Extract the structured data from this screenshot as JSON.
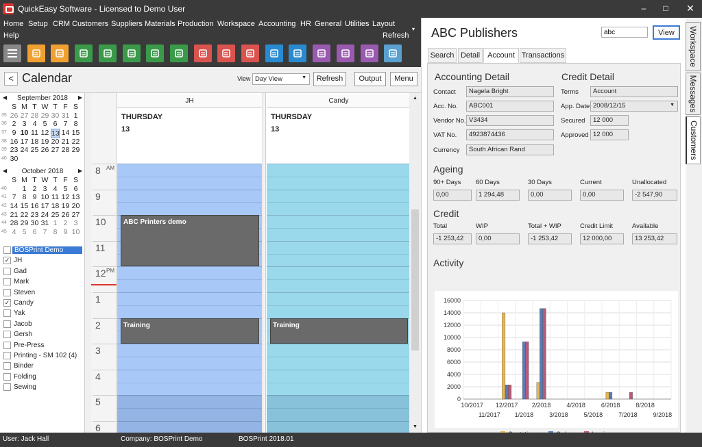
{
  "window": {
    "title": "QuickEasy Software - Licensed to Demo User"
  },
  "menu": [
    "Home",
    "Setup",
    "CRM",
    "Customers",
    "Suppliers",
    "Materials",
    "Production",
    "Workspace",
    "Accounting",
    "HR",
    "General",
    "Utilities",
    "Layout"
  ],
  "menu2": {
    "help": "Help",
    "refresh": "Refresh"
  },
  "toolbar_icons": [
    {
      "name": "menu-icon",
      "color": "#888888"
    },
    {
      "name": "calendar-icon",
      "color": "#f0a030"
    },
    {
      "name": "mail-icon",
      "color": "#f0a030"
    },
    {
      "name": "user-icon",
      "color": "#3a9a4a"
    },
    {
      "name": "chat-icon",
      "color": "#3a9a4a"
    },
    {
      "name": "cart-icon",
      "color": "#3a9a4a"
    },
    {
      "name": "truck-icon",
      "color": "#3a9a4a"
    },
    {
      "name": "document-icon",
      "color": "#3a9a4a"
    },
    {
      "name": "person-icon",
      "color": "#d9534f"
    },
    {
      "name": "cart-add-icon",
      "color": "#d9534f"
    },
    {
      "name": "invoice-icon",
      "color": "#d9534f"
    },
    {
      "name": "card-icon",
      "color": "#2a8ad0"
    },
    {
      "name": "transfer-icon",
      "color": "#2a8ad0"
    },
    {
      "name": "factory-icon",
      "color": "#9a5ab0"
    },
    {
      "name": "hierarchy-icon",
      "color": "#9a5ab0"
    },
    {
      "name": "hourglass-icon",
      "color": "#9a5ab0"
    },
    {
      "name": "book-icon",
      "color": "#5aa0d0"
    }
  ],
  "calendar": {
    "title": "Calendar",
    "view_label": "View",
    "view_value": "Day View",
    "refresh": "Refresh",
    "output": "Output",
    "menu": "Menu",
    "back": "<"
  },
  "minical1": {
    "title": "September 2018",
    "days": [
      "S",
      "M",
      "T",
      "W",
      "T",
      "F",
      "S"
    ],
    "weeks": [
      {
        "wk": "35",
        "days": [
          "26",
          "27",
          "28",
          "29",
          "30",
          "31",
          "1"
        ]
      },
      {
        "wk": "36",
        "days": [
          "2",
          "3",
          "4",
          "5",
          "6",
          "7",
          "8"
        ]
      },
      {
        "wk": "37",
        "days": [
          "9",
          "10",
          "11",
          "12",
          "13",
          "14",
          "15"
        ]
      },
      {
        "wk": "38",
        "days": [
          "16",
          "17",
          "18",
          "19",
          "20",
          "21",
          "22"
        ]
      },
      {
        "wk": "39",
        "days": [
          "23",
          "24",
          "25",
          "26",
          "27",
          "28",
          "29"
        ]
      },
      {
        "wk": "40",
        "days": [
          "30",
          "",
          "",
          "",
          "",
          "",
          ""
        ]
      }
    ]
  },
  "minical2": {
    "title": "October 2018",
    "days": [
      "S",
      "M",
      "T",
      "W",
      "T",
      "F",
      "S"
    ],
    "weeks": [
      {
        "wk": "40",
        "days": [
          "",
          "1",
          "2",
          "3",
          "4",
          "5",
          "6"
        ]
      },
      {
        "wk": "41",
        "days": [
          "7",
          "8",
          "9",
          "10",
          "11",
          "12",
          "13"
        ]
      },
      {
        "wk": "42",
        "days": [
          "14",
          "15",
          "16",
          "17",
          "18",
          "19",
          "20"
        ]
      },
      {
        "wk": "43",
        "days": [
          "21",
          "22",
          "23",
          "24",
          "25",
          "26",
          "27"
        ]
      },
      {
        "wk": "44",
        "days": [
          "28",
          "29",
          "30",
          "31",
          "1",
          "2",
          "3"
        ]
      },
      {
        "wk": "45",
        "days": [
          "4",
          "5",
          "6",
          "7",
          "8",
          "9",
          "10"
        ]
      }
    ]
  },
  "resources": [
    {
      "label": "BOSPrint Demo",
      "checked": false,
      "selected": true
    },
    {
      "label": "JH",
      "checked": true
    },
    {
      "label": "Gad",
      "checked": false
    },
    {
      "label": "Mark",
      "checked": false
    },
    {
      "label": "Steven",
      "checked": false
    },
    {
      "label": "Candy",
      "checked": true
    },
    {
      "label": "Yak",
      "checked": false
    },
    {
      "label": "Jacob",
      "checked": false
    },
    {
      "label": "Gersh",
      "checked": false
    },
    {
      "label": "Pre-Press",
      "checked": false
    },
    {
      "label": "Printing - SM 102 (4)",
      "checked": false
    },
    {
      "label": "Binder",
      "checked": false
    },
    {
      "label": "Folding",
      "checked": false
    },
    {
      "label": "Sewing",
      "checked": false
    }
  ],
  "dayview": {
    "columns": [
      {
        "name": "JH",
        "day": "THURSDAY",
        "date": "13",
        "color": "#a8c8f8"
      },
      {
        "name": "Candy",
        "day": "THURSDAY",
        "date": "13",
        "color": "#9ad8ec"
      }
    ],
    "hours": [
      {
        "h": "8",
        "suffix": "AM"
      },
      {
        "h": "9",
        "suffix": ""
      },
      {
        "h": "10",
        "suffix": ""
      },
      {
        "h": "11",
        "suffix": ""
      },
      {
        "h": "12",
        "suffix": "PM"
      },
      {
        "h": "1",
        "suffix": ""
      },
      {
        "h": "2",
        "suffix": ""
      },
      {
        "h": "3",
        "suffix": ""
      },
      {
        "h": "4",
        "suffix": ""
      },
      {
        "h": "5",
        "suffix": ""
      },
      {
        "h": "6",
        "suffix": ""
      }
    ],
    "appointments": [
      {
        "col": 0,
        "title": "ABC Printers demo",
        "start": 10,
        "end": 12
      },
      {
        "col": 0,
        "title": "Training",
        "start": 14,
        "end": 15
      },
      {
        "col": 1,
        "title": "Training",
        "start": 14,
        "end": 15
      }
    ]
  },
  "customer": {
    "name": "ABC Publishers",
    "search_value": "abc",
    "view": "View",
    "tabs": [
      "Search",
      "Detail",
      "Account",
      "Transactions"
    ],
    "active_tab": "Account",
    "accounting_detail": "Accounting Detail",
    "credit_detail": "Credit Detail",
    "fields": {
      "contact_label": "Contact",
      "contact": "Nagela Bright",
      "acc_label": "Acc. No.",
      "acc": "ABC001",
      "vendor_label": "Vendor No.",
      "vendor": "V3434",
      "vat_label": "VAT No.",
      "vat": "4923874436",
      "currency_label": "Currency",
      "currency": "South African Rand",
      "terms_label": "Terms",
      "terms": "Account",
      "appdate_label": "App. Date",
      "appdate": "2008/12/15",
      "secured_label": "Secured",
      "secured": "12 000",
      "approved_label": "Approved",
      "approved": "12 000"
    },
    "ageing": {
      "title": "Ageing",
      "labels": [
        "90+ Days",
        "60 Days",
        "30 Days",
        "Current",
        "Unallocated"
      ],
      "values": [
        "0,00",
        "1 294,48",
        "0,00",
        "0,00",
        "-2 547,90"
      ]
    },
    "credit": {
      "title": "Credit",
      "labels": [
        "Total",
        "WIP",
        "Total + WIP",
        "Credit Limit",
        "Available"
      ],
      "values": [
        "-1 253,42",
        "0,00",
        "-1 253,42",
        "12 000,00",
        "13 253,42"
      ]
    },
    "activity_title": "Activity"
  },
  "chart_data": {
    "type": "bar",
    "categories": [
      "10/2017",
      "11/2017",
      "12/2017",
      "1/2018",
      "2/2018",
      "3/2018",
      "4/2018",
      "5/2018",
      "6/2018",
      "7/2018",
      "8/2018",
      "9/2018"
    ],
    "series": [
      {
        "name": "Quotations",
        "color": "#e8b850",
        "values": [
          0,
          0,
          14000,
          0,
          2700,
          0,
          0,
          0,
          1100,
          0,
          0,
          0
        ]
      },
      {
        "name": "Orders",
        "color": "#5a7ab8",
        "values": [
          0,
          0,
          2300,
          9300,
          14700,
          0,
          0,
          0,
          1100,
          0,
          0,
          0
        ]
      },
      {
        "name": "Invoices",
        "color": "#b85a7a",
        "values": [
          0,
          0,
          2300,
          9300,
          14700,
          0,
          0,
          0,
          0,
          1100,
          0,
          0
        ]
      }
    ],
    "ylim": [
      0,
      16000
    ],
    "yticks": [
      0,
      2000,
      4000,
      6000,
      8000,
      10000,
      12000,
      14000,
      16000
    ],
    "grid": true,
    "legend": "bottom"
  },
  "side_tabs": [
    "Workspace",
    "Messages",
    "Customers"
  ],
  "status": {
    "user": "User: Jack Hall",
    "company": "Company: BOSPrint Demo",
    "version": "BOSPrint 2018.01"
  }
}
